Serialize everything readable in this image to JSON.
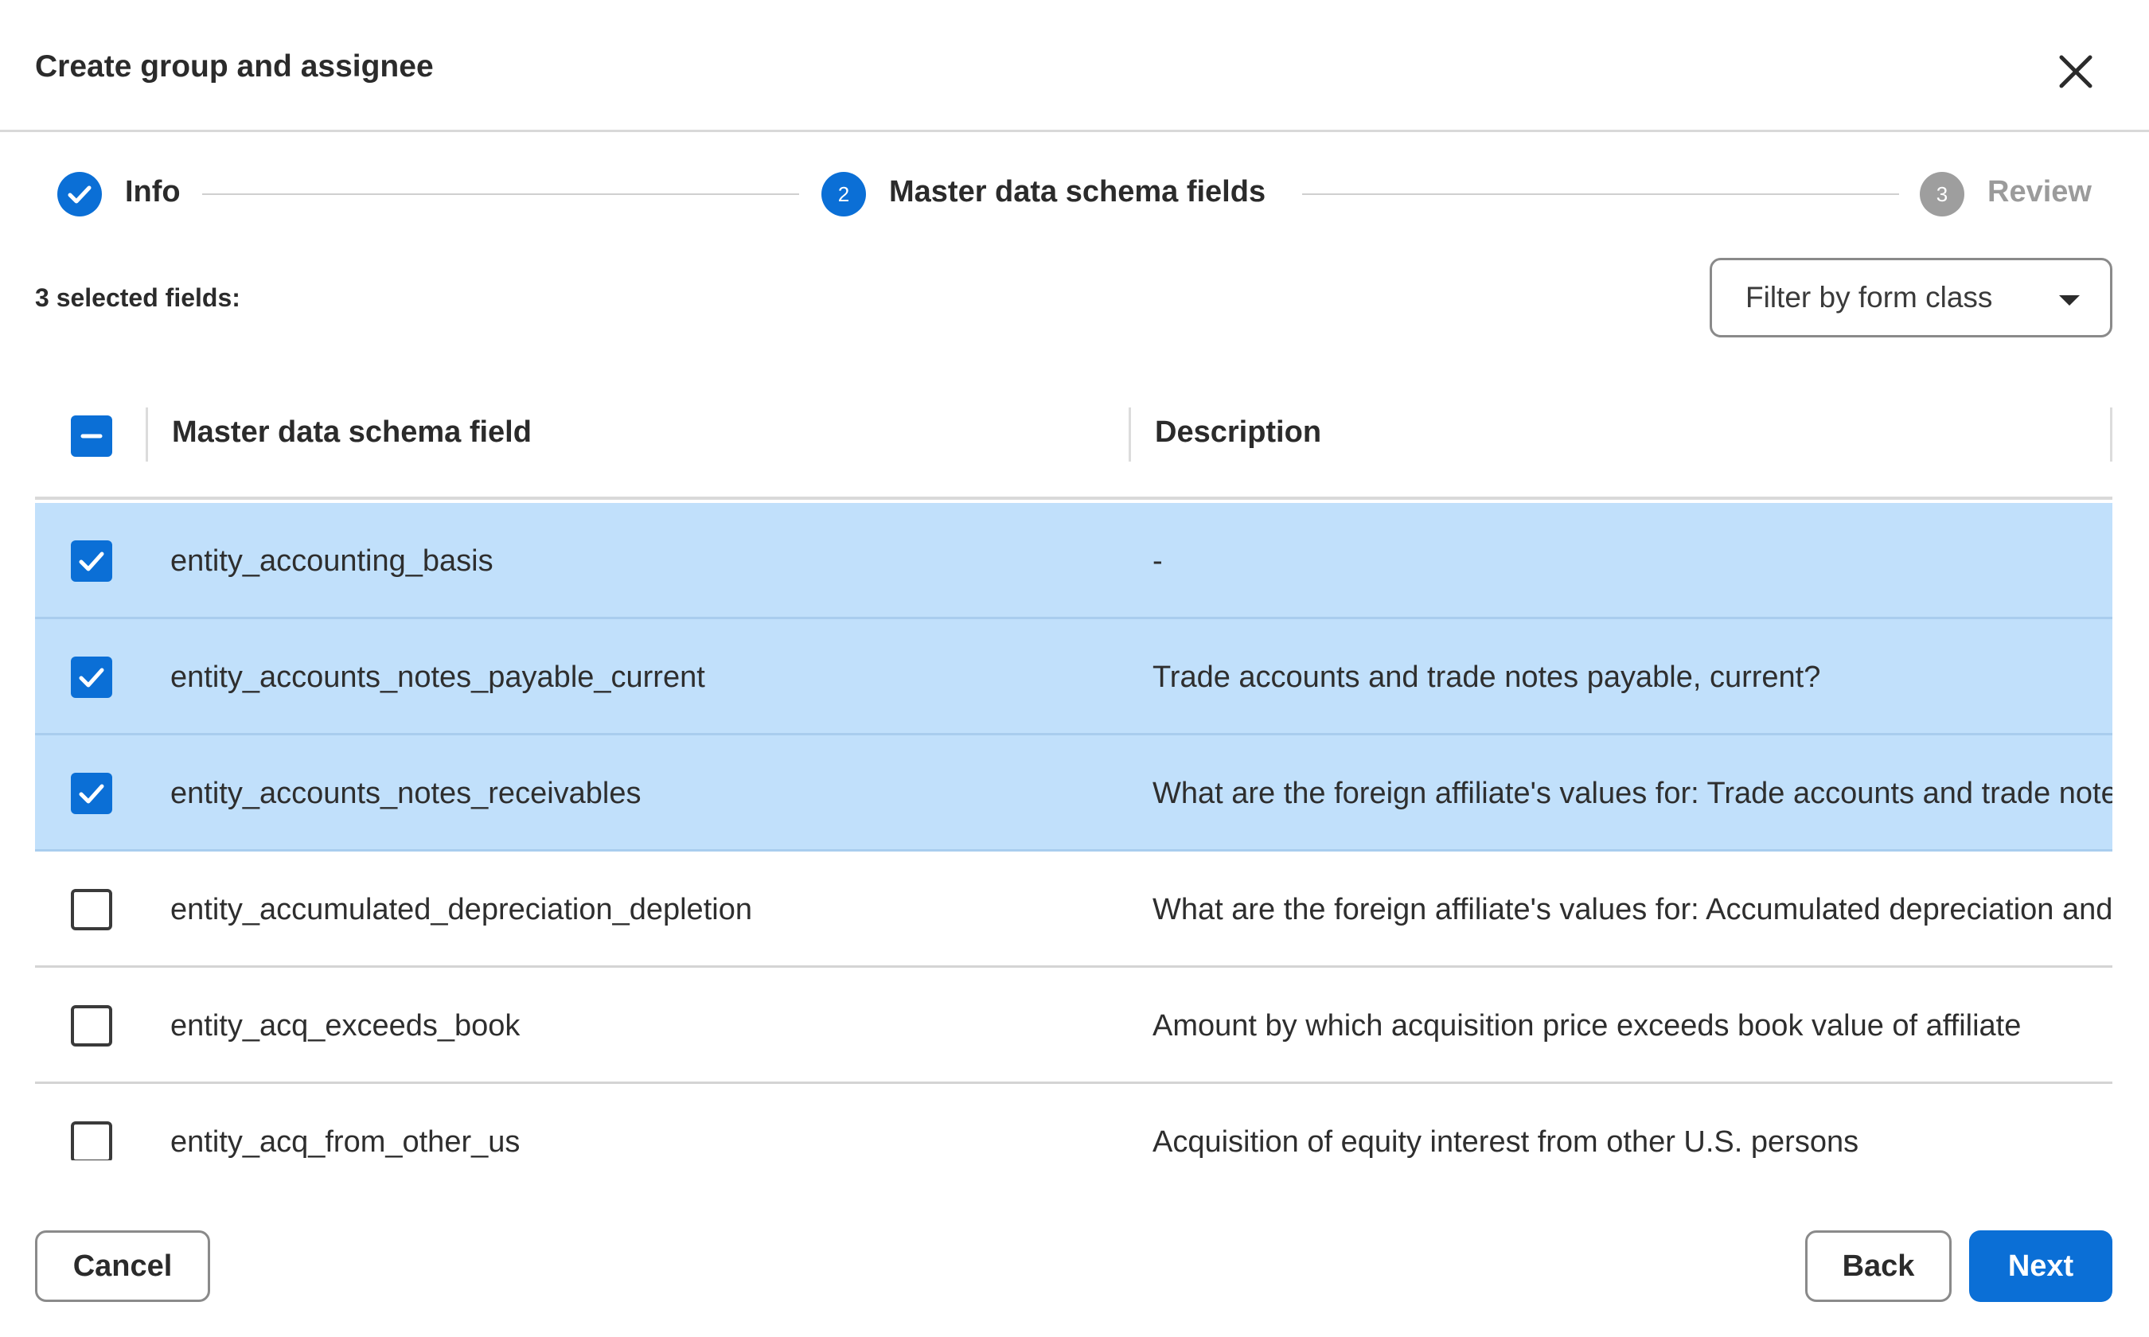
{
  "header": {
    "title": "Create group and assignee"
  },
  "stepper": {
    "steps": [
      {
        "label": "Info",
        "number": "1",
        "state": "done"
      },
      {
        "label": "Master data schema fields",
        "number": "2",
        "state": "active"
      },
      {
        "label": "Review",
        "number": "3",
        "state": "todo"
      }
    ]
  },
  "selection": {
    "count_label": "3 selected fields:"
  },
  "filter": {
    "label": "Filter by form class"
  },
  "table": {
    "columns": [
      "Master data schema field",
      "Description"
    ],
    "rows": [
      {
        "field": "entity_accounting_basis",
        "description": "-",
        "selected": true
      },
      {
        "field": "entity_accounts_notes_payable_current",
        "description": "Trade accounts and trade notes payable, current?",
        "selected": true
      },
      {
        "field": "entity_accounts_notes_receivables",
        "description": "What are the foreign affiliate's values for: Trade accounts and trade notes receivable",
        "selected": true
      },
      {
        "field": "entity_accumulated_depreciation_depletion",
        "description": "What are the foreign affiliate's values for: Accumulated depreciation and depletion",
        "selected": false
      },
      {
        "field": "entity_acq_exceeds_book",
        "description": "Amount by which acquisition price exceeds book value of affiliate",
        "selected": false
      },
      {
        "field": "entity_acq_from_other_us",
        "description": "Acquisition of equity interest from other U.S. persons",
        "selected": false
      }
    ]
  },
  "footer": {
    "cancel_label": "Cancel",
    "back_label": "Back",
    "next_label": "Next"
  },
  "colors": {
    "accent": "#0b6fd6",
    "selected_row": "#c1e0fb",
    "todo_step": "#9e9e9e"
  }
}
